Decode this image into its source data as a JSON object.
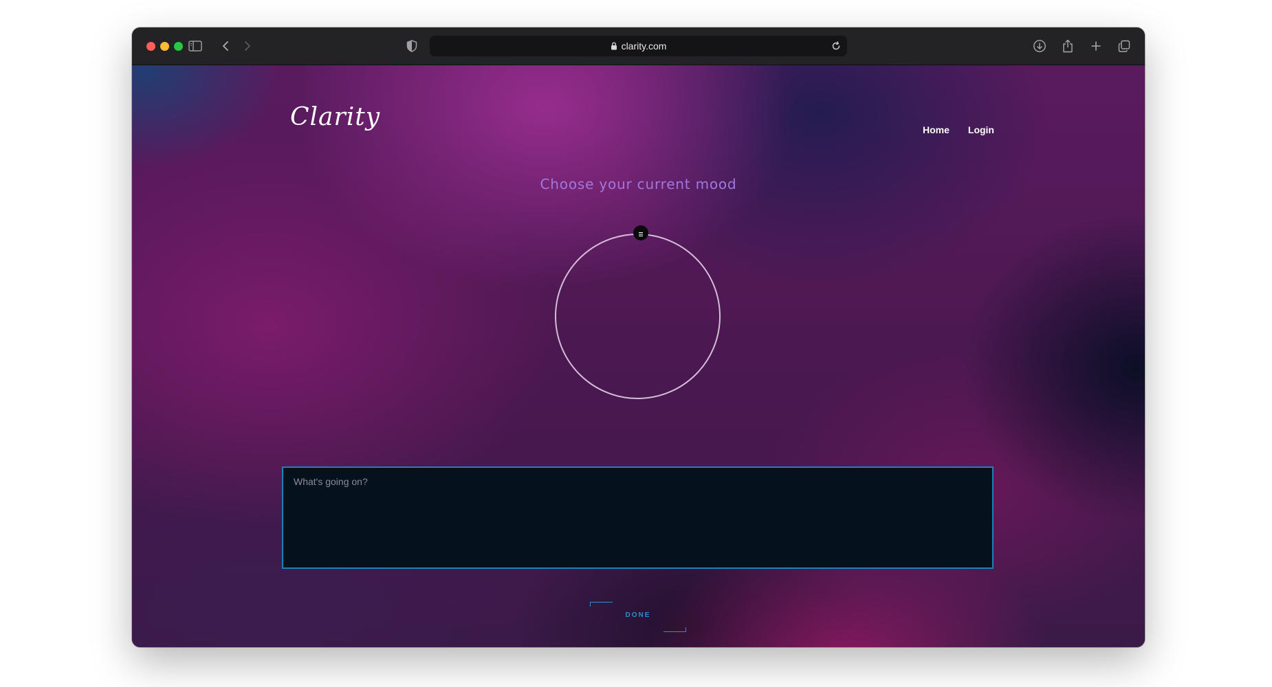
{
  "browser": {
    "url": "clarity.com",
    "icons": {
      "sidebar": "sidebar-icon",
      "back": "chevron-left-icon",
      "forward": "chevron-right-icon",
      "shield": "shield-icon",
      "lock": "lock-icon",
      "reload": "reload-icon",
      "download": "download-icon",
      "share": "share-icon",
      "new_tab": "plus-icon",
      "tabs": "tabs-overview-icon"
    }
  },
  "site": {
    "logo": "Clarity",
    "nav": {
      "home": "Home",
      "login": "Login"
    }
  },
  "mood": {
    "title": "Choose your current mood",
    "handle_icon": "drag-handle-icon"
  },
  "journal": {
    "placeholder": "What's going on?",
    "value": ""
  },
  "done_button": {
    "label": "DONE"
  },
  "colors": {
    "accent_blue": "#2a8fd0",
    "mood_title": "#a178e0",
    "textarea_bg": "#06111e"
  }
}
